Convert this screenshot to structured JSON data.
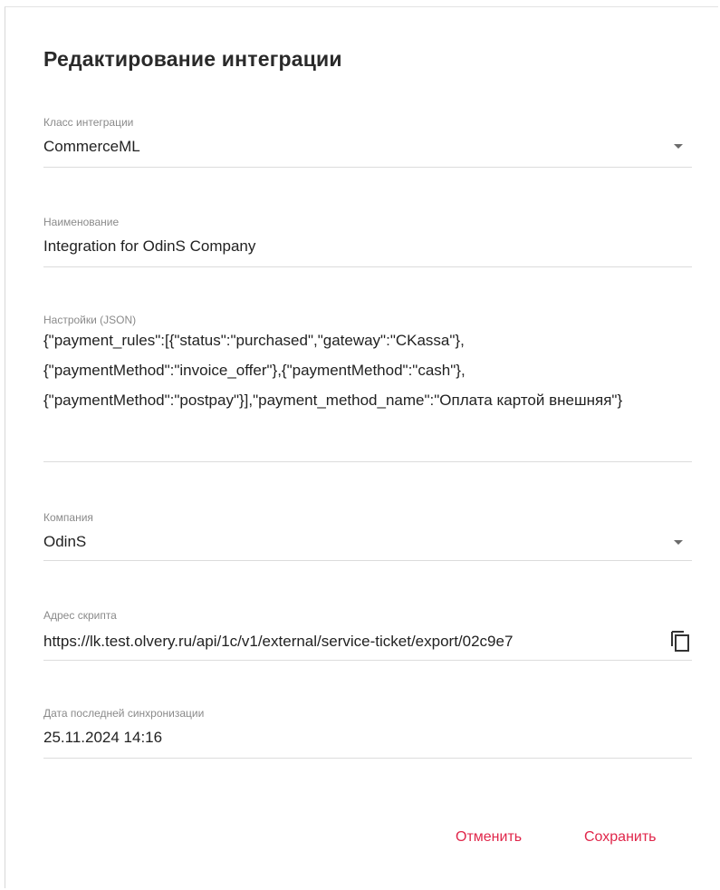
{
  "dialog": {
    "title": "Редактирование интеграции"
  },
  "fields": {
    "integration_class": {
      "label": "Класс интеграции",
      "value": "CommerceML"
    },
    "name": {
      "label": "Наименование",
      "value": "Integration for OdinS Company"
    },
    "settings": {
      "label": "Настройки (JSON)",
      "value": "{\"payment_rules\":[{\"status\":\"purchased\",\"gateway\":\"CKassa\"}, {\"paymentMethod\":\"invoice_offer\"},{\"paymentMethod\":\"cash\"}, {\"paymentMethod\":\"postpay\"}],\"payment_method_name\":\"Оплата картой внешняя\"}"
    },
    "company": {
      "label": "Компания",
      "value": "OdinS"
    },
    "script_url": {
      "label": "Адрес скрипта",
      "value": "https://lk.test.olvery.ru/api/1c/v1/external/service-ticket/export/02c9e7"
    },
    "last_sync": {
      "label": "Дата последней синхронизации",
      "value": "25.11.2024 14:16"
    }
  },
  "actions": {
    "cancel_label": "Отменить",
    "save_label": "Сохранить"
  },
  "icons": {
    "dropdown": "chevron-down-icon",
    "copy": "copy-icon"
  },
  "colors": {
    "accent": "#e0264a",
    "label": "#8a8a8a",
    "text": "#222222"
  }
}
